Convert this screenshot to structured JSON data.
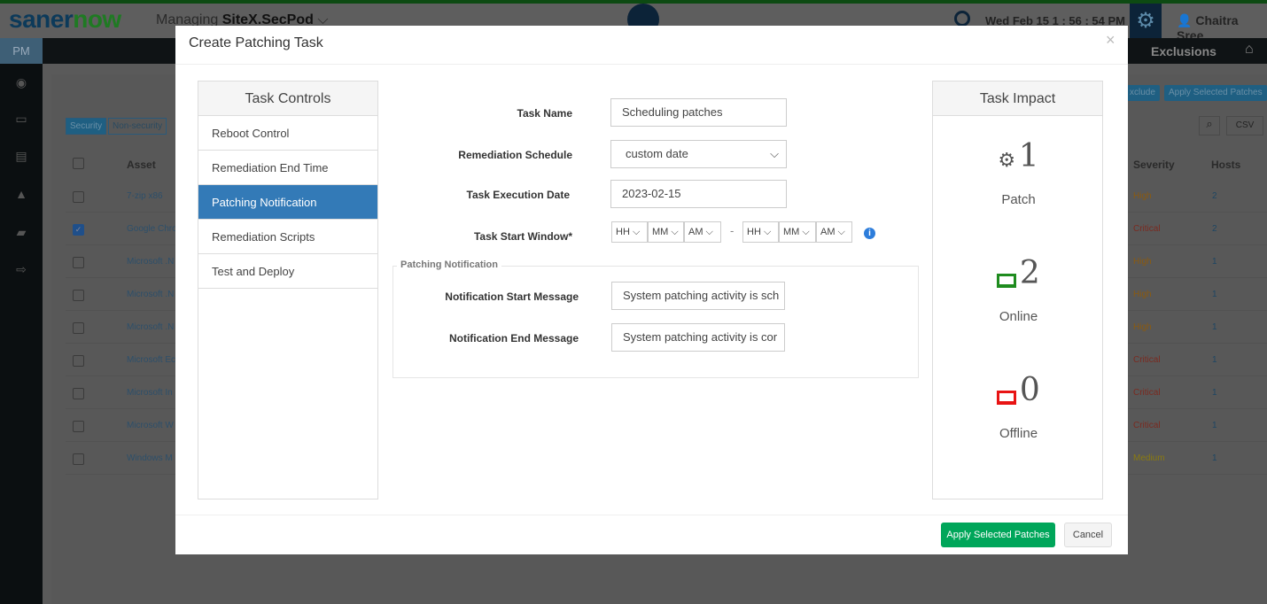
{
  "app": {
    "logo_a": "saner",
    "logo_b": "now",
    "managing_label": "Managing",
    "site": "SiteX.SecPod",
    "datetime": "Wed Feb 15  1 : 56 : 54 PM",
    "user": "Chaitra Sree",
    "module": "PM",
    "nav_exclusions": "Exclusions"
  },
  "background": {
    "exclude_btn": "xclude",
    "apply_btn": "Apply Selected Patches",
    "tabs": [
      "Security",
      "Non-security"
    ],
    "csv": "CSV",
    "columns": {
      "asset": "Asset",
      "severity": "Severity",
      "hosts": "Hosts"
    },
    "rows": [
      {
        "asset": "7-zip x86",
        "severity": "High",
        "hosts": "2",
        "checked": false
      },
      {
        "asset": "Google Chro",
        "severity": "Critical",
        "hosts": "2",
        "checked": true
      },
      {
        "asset": "Microsoft .N",
        "severity": "High",
        "hosts": "1",
        "checked": false
      },
      {
        "asset": "Microsoft .N",
        "severity": "High",
        "hosts": "1",
        "checked": false
      },
      {
        "asset": "Microsoft .N",
        "severity": "High",
        "hosts": "1",
        "checked": false
      },
      {
        "asset": "Microsoft Ec",
        "severity": "Critical",
        "hosts": "1",
        "checked": false
      },
      {
        "asset": "Microsoft In",
        "severity": "Critical",
        "hosts": "1",
        "checked": false
      },
      {
        "asset": "Microsoft W",
        "severity": "Critical",
        "hosts": "1",
        "checked": false
      },
      {
        "asset": "Windows M",
        "severity": "Medium",
        "hosts": "1",
        "checked": false
      }
    ]
  },
  "modal": {
    "title": "Create Patching Task",
    "close": "×",
    "task_controls": {
      "title": "Task Controls",
      "items": [
        "Reboot Control",
        "Remediation End Time",
        "Patching Notification",
        "Remediation Scripts",
        "Test and Deploy"
      ],
      "active": "Patching Notification"
    },
    "form": {
      "task_name_label": "Task Name",
      "task_name": "Scheduling patches",
      "schedule_label": "Remediation Schedule",
      "schedule": "custom date",
      "exec_date_label": "Task Execution Date",
      "exec_date": "2023-02-15",
      "window_label": "Task Start Window*",
      "start": [
        "HH",
        "MM",
        "AM"
      ],
      "dash": "-",
      "end": [
        "HH",
        "MM",
        "AM"
      ]
    },
    "notification": {
      "legend": "Patching Notification",
      "start_label": "Notification Start Message",
      "start_msg": "System patching activity is sch",
      "end_label": "Notification End Message",
      "end_msg": "System patching activity is cor"
    },
    "impact": {
      "title": "Task Impact",
      "patch_count": "1",
      "patch_label": "Patch",
      "online_count": "2",
      "online_label": "Online",
      "offline_count": "0",
      "offline_label": "Offline"
    },
    "apply": "Apply Selected Patches",
    "cancel": "Cancel"
  },
  "colors": {
    "online": "#1f8c1f",
    "offline": "#e81414",
    "primary": "#337ab7",
    "success": "#00a65a",
    "high": "#8a5a10",
    "critical": "#7a2a20",
    "medium": "#8a7a10"
  }
}
